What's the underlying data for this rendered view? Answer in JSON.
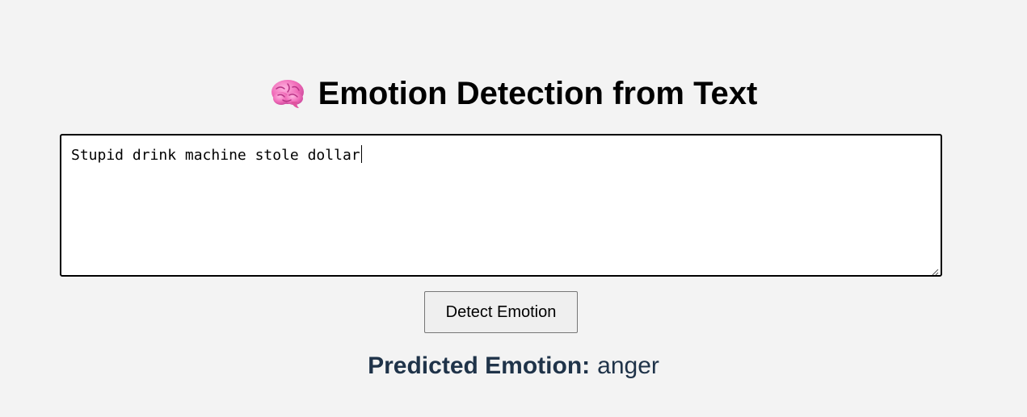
{
  "header": {
    "icon": "brain-icon",
    "title": "Emotion Detection from Text"
  },
  "input": {
    "value": "Stupid drink machine stole dollar"
  },
  "actions": {
    "detect_label": "Detect Emotion"
  },
  "result": {
    "label": "Predicted Emotion:",
    "value": "anger"
  },
  "colors": {
    "background": "#f3f3f3",
    "result_text": "#1f3349",
    "icon_pink": "#f06bb8"
  }
}
